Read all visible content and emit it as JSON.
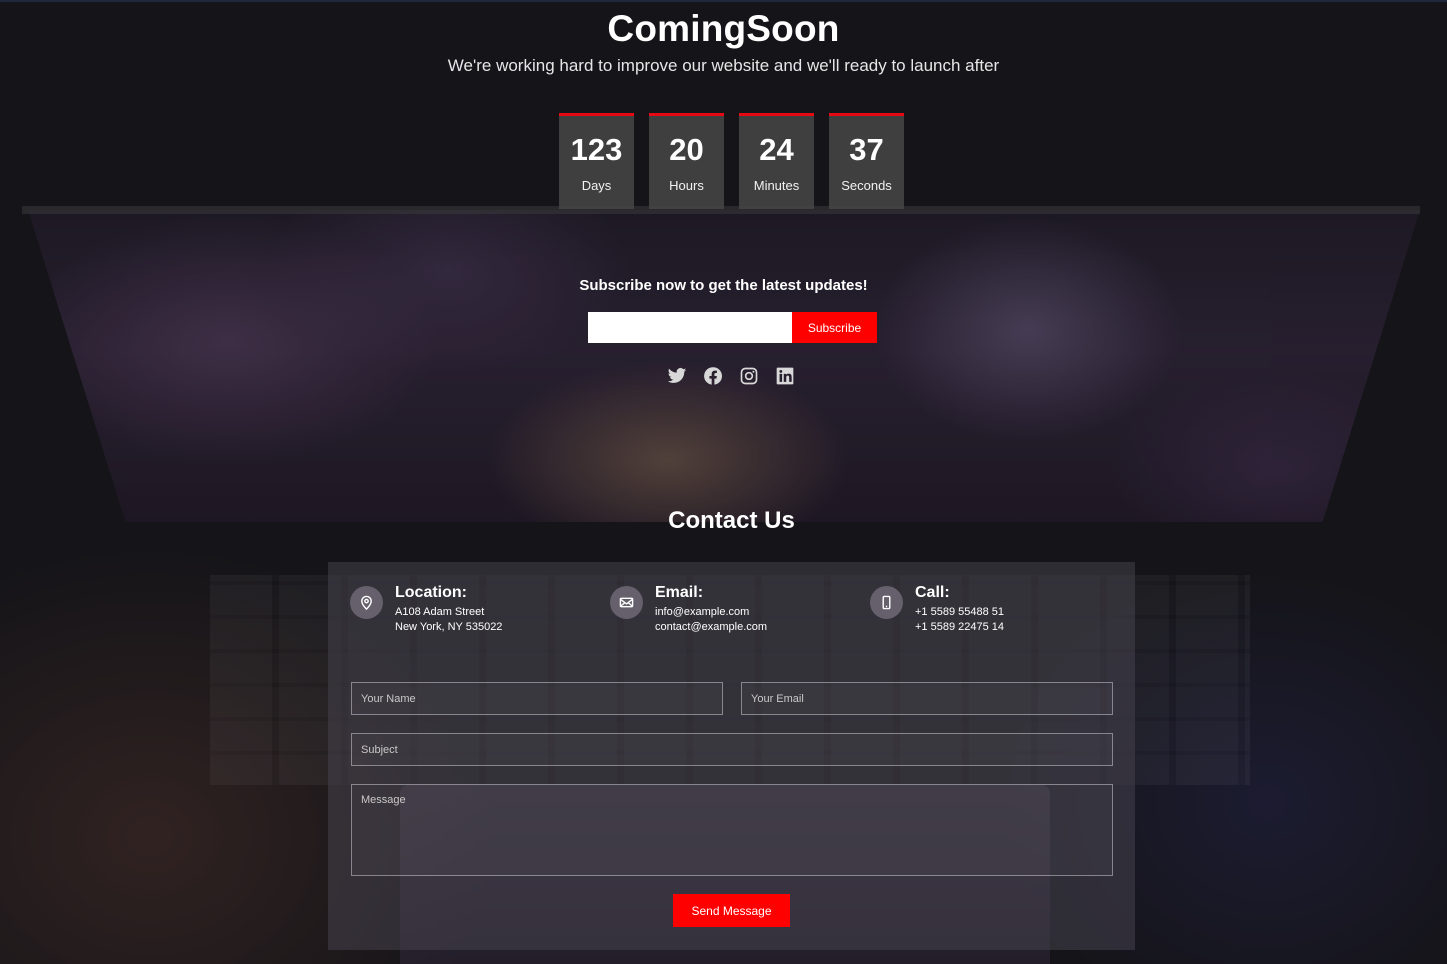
{
  "header": {
    "title": "ComingSoon",
    "subtitle": "We're working hard to improve our website and we'll ready to launch after"
  },
  "countdown": [
    {
      "value": "123",
      "label": "Days"
    },
    {
      "value": "20",
      "label": "Hours"
    },
    {
      "value": "24",
      "label": "Minutes"
    },
    {
      "value": "37",
      "label": "Seconds"
    }
  ],
  "subscribe": {
    "heading": "Subscribe now to get the latest updates!",
    "email_value": "",
    "button_label": "Subscribe"
  },
  "social": [
    "twitter-icon",
    "facebook-icon",
    "instagram-icon",
    "linkedin-icon"
  ],
  "contact": {
    "title": "Contact Us",
    "location": {
      "title": "Location:",
      "line1": "A108 Adam Street",
      "line2": "New York, NY 535022"
    },
    "email": {
      "title": "Email:",
      "line1": "info@example.com",
      "line2": "contact@example.com"
    },
    "call": {
      "title": "Call:",
      "line1": "+1 5589 55488 51",
      "line2": "+1 5589 22475 14"
    },
    "form": {
      "name_placeholder": "Your Name",
      "email_placeholder": "Your Email",
      "subject_placeholder": "Subject",
      "message_placeholder": "Message",
      "send_label": "Send Message"
    }
  },
  "colors": {
    "accent": "#ff0000",
    "countdown_border": "#e50914"
  }
}
